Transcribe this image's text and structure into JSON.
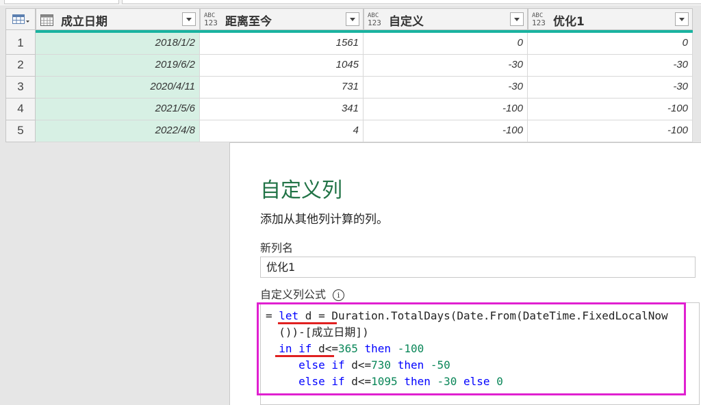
{
  "table": {
    "columns": [
      {
        "type_icon": "calendar-icon",
        "type_text": "",
        "name": "成立日期"
      },
      {
        "type_icon": "any-type-icon",
        "type_text": "ABC123",
        "name": "距离至今"
      },
      {
        "type_icon": "any-type-icon",
        "type_text": "ABC123",
        "name": "自定义"
      },
      {
        "type_icon": "any-type-icon",
        "type_text": "ABC123",
        "name": "优化1"
      }
    ],
    "rows": [
      {
        "n": "1",
        "date": "2018/1/2",
        "dist": "1561",
        "custom": "0",
        "opt": "0"
      },
      {
        "n": "2",
        "date": "2019/6/2",
        "dist": "1045",
        "custom": "-30",
        "opt": "-30"
      },
      {
        "n": "3",
        "date": "2020/4/11",
        "dist": "731",
        "custom": "-30",
        "opt": "-30"
      },
      {
        "n": "4",
        "date": "2021/5/6",
        "dist": "341",
        "custom": "-100",
        "opt": "-100"
      },
      {
        "n": "5",
        "date": "2022/4/8",
        "dist": "4",
        "custom": "-100",
        "opt": "-100"
      }
    ],
    "accent_color": "#19b3a0",
    "selected_column_color": "#d7f0e4"
  },
  "dialog": {
    "title": "自定义列",
    "subtitle": "添加从其他列计算的列。",
    "name_label": "新列名",
    "name_value": "优化1",
    "formula_label": "自定义列公式",
    "info_glyph": "i",
    "highlight_color": "#e020d0",
    "formula": {
      "eq": "= ",
      "let": "let",
      "l1_mid": " d = Duration.TotalDays(Date.From(DateTime.FixedLocalNow",
      "l2": "())-[成立日期])",
      "in": "in",
      "if1": "if",
      "l3_cond": " d<=",
      "n365": "365",
      "then": "then",
      "v100": "-100",
      "else": "else",
      "if2": "if",
      "l4_cond": " d<=",
      "n730": "730",
      "v50": "-50",
      "n1095": "1095",
      "v30": "-30",
      "v0": "0"
    }
  }
}
